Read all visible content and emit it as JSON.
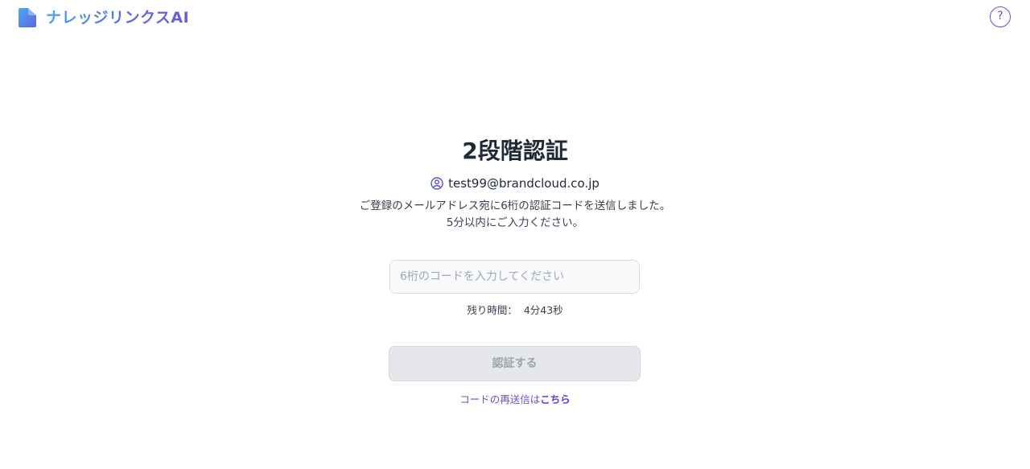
{
  "header": {
    "brand": "ナレッジリンクスAI",
    "logo_icon": "document-icon",
    "help_label": "?",
    "help_icon": "question-icon",
    "accent": "#5a55d8"
  },
  "main": {
    "title": "2段階認証",
    "email": "test99@brandcloud.co.jp",
    "user_icon": "user-circle-icon",
    "description_line1": "ご登録のメールアドレス宛に6桁の認証コードを送信しました。",
    "description_line2": "5分以内にご入力ください。",
    "code_input": {
      "value": "",
      "placeholder": "6桁のコードを入力してください"
    },
    "timer_label": "残り時間：",
    "timer_value": "4分43秒",
    "submit_label": "認証する",
    "resend_text": "コードの再送信は",
    "resend_link": "こちら"
  }
}
